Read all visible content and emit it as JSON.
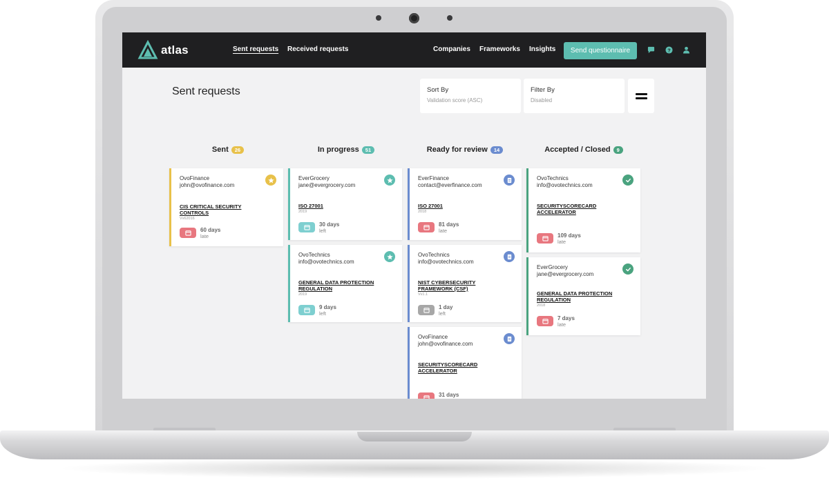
{
  "app": {
    "logo_text": "atlas"
  },
  "nav": {
    "sent_requests": "Sent requests",
    "received_requests": "Received requests",
    "companies": "Companies",
    "frameworks": "Frameworks",
    "insights": "Insights",
    "send_questionnaire": "Send questionnaire"
  },
  "page": {
    "title": "Sent requests",
    "sort_label": "Sort By",
    "sort_value": "Validation score (ASC)",
    "filter_label": "Filter By",
    "filter_value": "Disabled"
  },
  "columns": [
    {
      "title": "Sent",
      "count": "26",
      "color": "#e8c14a"
    },
    {
      "title": "In progress",
      "count": "51",
      "color": "#5dbdb0"
    },
    {
      "title": "Ready for review",
      "count": "14",
      "color": "#6b8ccf"
    },
    {
      "title": "Accepted / Closed",
      "count": "9",
      "color": "#4aa37f"
    }
  ],
  "cards": {
    "sent_1": {
      "company": "OvoFinance",
      "email": "john@ovofinance.com",
      "framework": "CIS CRITICAL SECURITY CONTROLS",
      "version": "Vv62016",
      "days": "60 days",
      "label": "late",
      "icon": "star-icon"
    },
    "prog_1": {
      "company": "EverGrocery",
      "email": "jane@evergrocery.com",
      "framework": "ISO 27001",
      "version": "2019",
      "days": "30 days",
      "label": "left",
      "icon": "star-icon"
    },
    "prog_2": {
      "company": "OvoTechnics",
      "email": "info@ovotechnics.com",
      "framework": "GENERAL DATA PROTECTION REGULATION",
      "version": "2019",
      "days": "9 days",
      "label": "left",
      "icon": "star-icon"
    },
    "rev_1": {
      "company": "EverFinance",
      "email": "contact@everfinance.com",
      "framework": "ISO 27001",
      "version": "2018",
      "days": "81 days",
      "label": "late",
      "icon": "document-icon"
    },
    "rev_2": {
      "company": "OvoTechnics",
      "email": "info@ovotechnics.com",
      "framework": "NIST CYBERSECURITY FRAMEWORK (CSF)",
      "version": "Vv1.1",
      "days": "1 day",
      "label": "left",
      "icon": "document-icon"
    },
    "rev_3": {
      "company": "OvoFinance",
      "email": "john@ovofinance.com",
      "framework": "SECURITYSCORECARD ACCELERATOR",
      "days": "31 days",
      "icon": "document-icon"
    },
    "acc_1": {
      "company": "OvoTechnics",
      "email": "info@ovotechnics.com",
      "framework": "SECURITYSCORECARD ACCELERATOR",
      "days": "109 days",
      "label": "late",
      "icon": "check-icon"
    },
    "acc_2": {
      "company": "EverGrocery",
      "email": "jane@evergrocery.com",
      "framework": "GENERAL DATA PROTECTION REGULATION",
      "version": "2018",
      "days": "7 days",
      "label": "late",
      "icon": "check-icon"
    }
  },
  "colors": {
    "nav_bg": "#1f1f21",
    "accent": "#5dbdb0",
    "late": "#e8777f",
    "left_ok": "#7ecfd0",
    "left_urgent": "#a7a7a7"
  }
}
